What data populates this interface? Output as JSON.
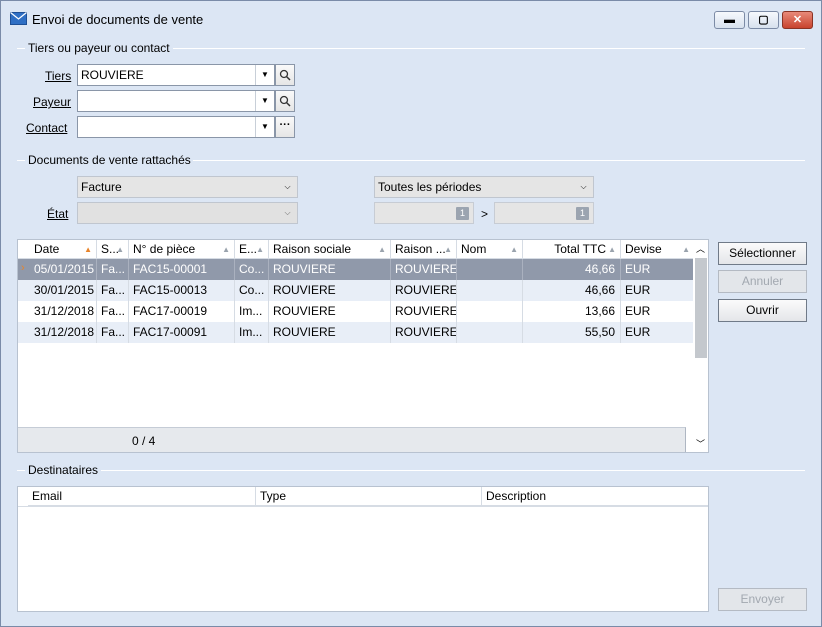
{
  "window": {
    "title": "Envoi de documents de vente",
    "min_label": "▬",
    "max_label": "▢",
    "close_label": "✕"
  },
  "tiers_section": {
    "title": "Tiers ou payeur ou contact",
    "tiers_label": "Tiers",
    "tiers_value": "ROUVIERE",
    "payeur_label": "Payeur",
    "payeur_value": "",
    "contact_label": "Contact",
    "contact_value": ""
  },
  "docs_section": {
    "title": "Documents de vente rattachés",
    "type_value": "Facture",
    "periode_value": "Toutes les périodes",
    "etat_label": "État",
    "etat_value": "",
    "date_from": "",
    "date_to": "",
    "range_sep": ">"
  },
  "grid": {
    "columns": [
      "Date",
      "S...",
      "N° de pièce",
      "E...",
      "Raison sociale",
      "Raison ...",
      "Nom",
      "Total TTC",
      "Devise"
    ],
    "rows": [
      [
        "05/01/2015",
        "Fa...",
        "FAC15-00001",
        "Co...",
        "ROUVIERE",
        "ROUVIERE",
        "",
        "46,66",
        "EUR"
      ],
      [
        "30/01/2015",
        "Fa...",
        "FAC15-00013",
        "Co...",
        "ROUVIERE",
        "ROUVIERE",
        "",
        "46,66",
        "EUR"
      ],
      [
        "31/12/2018",
        "Fa...",
        "FAC17-00019",
        "Im...",
        "ROUVIERE",
        "ROUVIERE",
        "",
        "13,66",
        "EUR"
      ],
      [
        "31/12/2018",
        "Fa...",
        "FAC17-00091",
        "Im...",
        "ROUVIERE",
        "ROUVIERE",
        "",
        "55,50",
        "EUR"
      ]
    ],
    "footer": "0 / 4"
  },
  "actions": {
    "selectionner": "Sélectionner",
    "annuler": "Annuler",
    "ouvrir": "Ouvrir",
    "envoyer": "Envoyer"
  },
  "destinataires": {
    "title": "Destinataires",
    "columns": [
      "Email",
      "Type",
      "Description"
    ]
  },
  "colors": {
    "window_bg": "#dce6f4",
    "selected_row": "#9099aa",
    "alt_row": "#e8eef7",
    "sort_accent": "#e8842a"
  }
}
